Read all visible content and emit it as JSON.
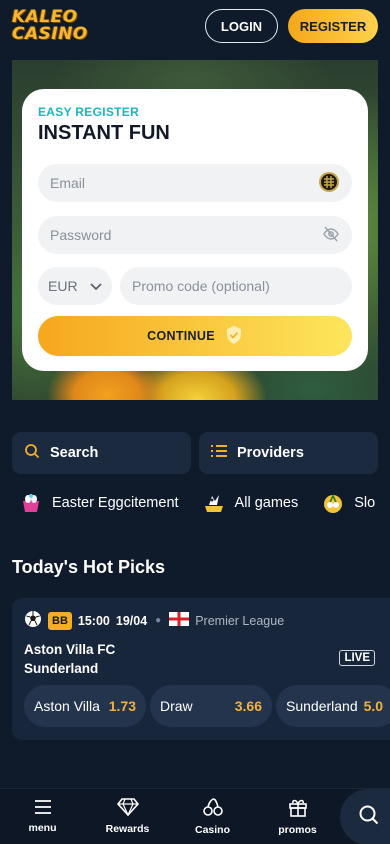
{
  "brand": {
    "logo_line1": "KALEO",
    "logo_line2": "CASINO"
  },
  "header": {
    "login": "LOGIN",
    "register": "REGISTER"
  },
  "form": {
    "eyebrow": "EASY REGISTER",
    "title": "INSTANT FUN",
    "email_placeholder": "Email",
    "password_placeholder": "Password",
    "currency": "EUR",
    "promo_placeholder": "Promo code (optional)",
    "continue": "CONTINUE"
  },
  "quick": {
    "search": "Search",
    "providers": "Providers"
  },
  "categories": [
    {
      "label": "Easter Eggcitement",
      "icon": "easter-egg-icon"
    },
    {
      "label": "All games",
      "icon": "all-games-icon"
    },
    {
      "label": "Slo",
      "icon": "slots-icon"
    }
  ],
  "hot_picks": {
    "title": "Today's Hot Picks",
    "match": {
      "badge": "BB",
      "time": "15:00",
      "date": "19/04",
      "league": "Premier League",
      "home": "Aston Villa FC",
      "away": "Sunderland",
      "live": "LIVE",
      "odds": [
        {
          "label": "Aston Villa",
          "value": "1.73"
        },
        {
          "label": "Draw",
          "value": "3.66"
        },
        {
          "label": "Sunderland",
          "value": "5.0"
        }
      ]
    }
  },
  "nav": {
    "menu": "menu",
    "rewards": "Rewards",
    "casino": "Casino",
    "promos": "promos"
  },
  "colors": {
    "accent": "#f5a81c",
    "background": "#0f1a2b",
    "card": "#18263b",
    "teal": "#19b7c6"
  }
}
